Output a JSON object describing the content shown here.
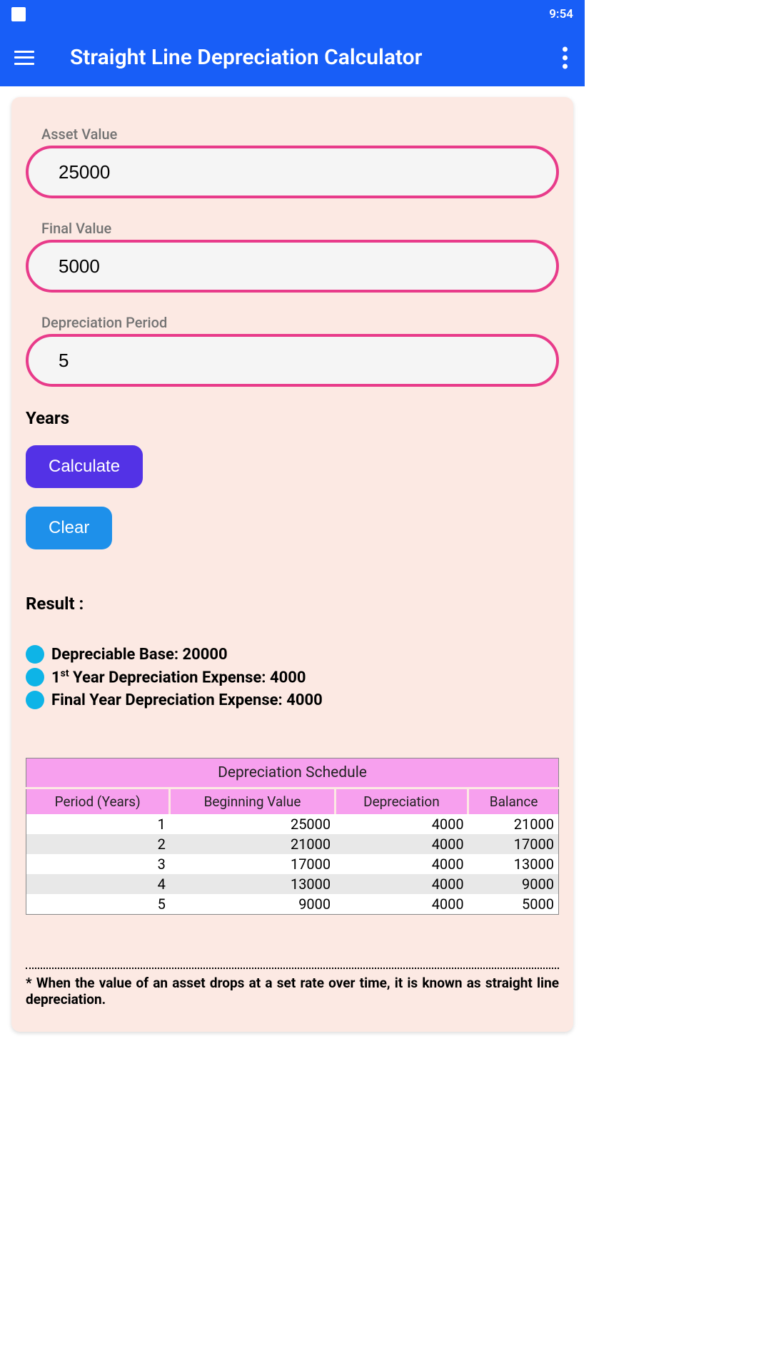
{
  "statusBar": {
    "time": "9:54"
  },
  "appBar": {
    "title": "Straight Line Depreciation Calculator"
  },
  "fields": {
    "assetValue": {
      "label": "Asset Value",
      "value": "25000"
    },
    "finalValue": {
      "label": "Final Value",
      "value": "5000"
    },
    "period": {
      "label": "Depreciation Period",
      "value": "5"
    }
  },
  "yearsLabel": "Years",
  "buttons": {
    "calculate": "Calculate",
    "clear": "Clear"
  },
  "results": {
    "heading": "Result :",
    "base": "Depreciable Base: 20000",
    "firstPrefix": "1",
    "firstSup": "st",
    "firstSuffix": " Year Depreciation Expense: 4000",
    "final": "Final Year Depreciation Expense: 4000"
  },
  "schedule": {
    "title": "Depreciation Schedule",
    "headers": {
      "period": "Period (Years)",
      "beginning": "Beginning Value",
      "depreciation": "Depreciation",
      "balance": "Balance"
    },
    "rows": [
      {
        "period": "1",
        "beginning": "25000",
        "depreciation": "4000",
        "balance": "21000"
      },
      {
        "period": "2",
        "beginning": "21000",
        "depreciation": "4000",
        "balance": "17000"
      },
      {
        "period": "3",
        "beginning": "17000",
        "depreciation": "4000",
        "balance": "13000"
      },
      {
        "period": "4",
        "beginning": "13000",
        "depreciation": "4000",
        "balance": "9000"
      },
      {
        "period": "5",
        "beginning": "9000",
        "depreciation": "4000",
        "balance": "5000"
      }
    ]
  },
  "note": "* When the value of an asset drops at a set rate over time, it is known as straight line depreciation."
}
